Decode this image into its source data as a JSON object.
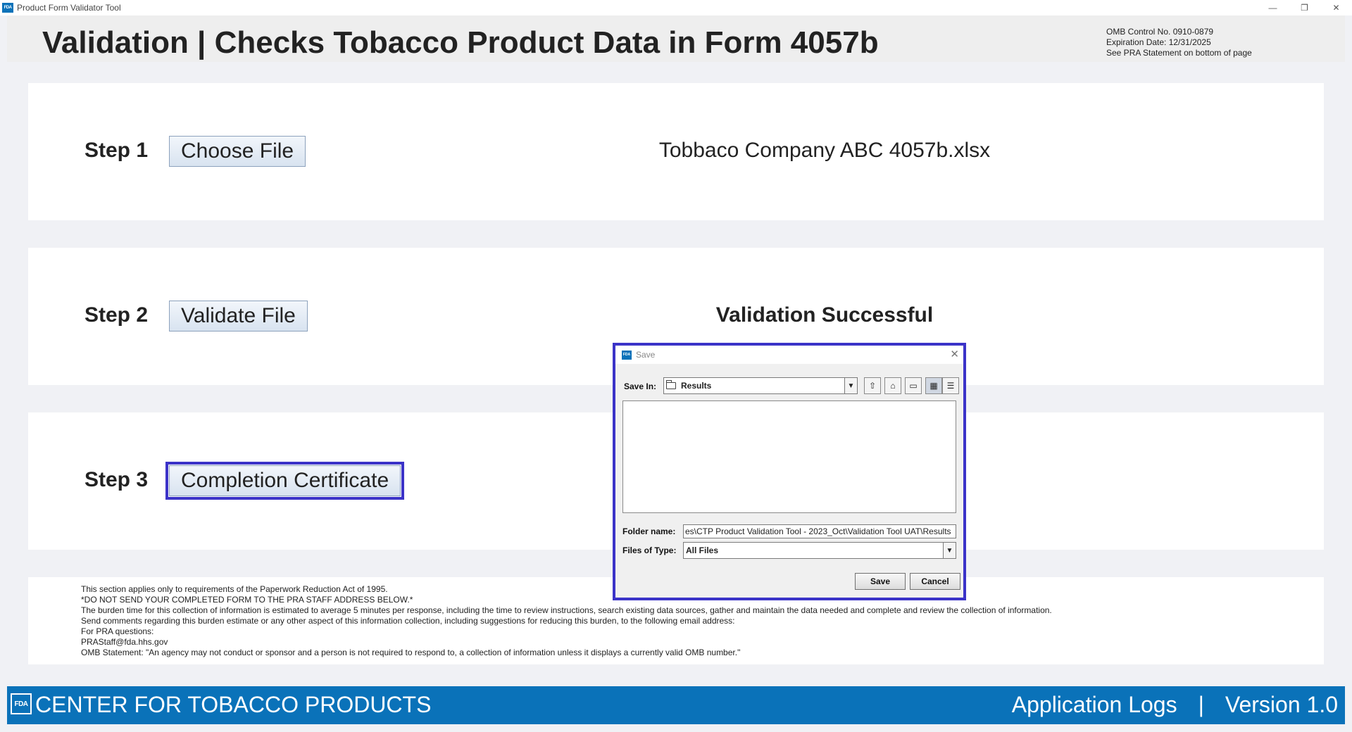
{
  "window": {
    "logo_text": "FDA",
    "title": "Product Form Validator Tool",
    "minimize": "—",
    "restore": "❐",
    "close": "✕"
  },
  "header": {
    "title": "Validation | Checks Tobacco Product Data in Form 4057b",
    "omb_control": "OMB Control No. 0910-0879",
    "expiration": "Expiration Date: 12/31/2025",
    "pra_note": "See PRA Statement on bottom of page"
  },
  "steps": {
    "step1": {
      "label": "Step 1",
      "button": "Choose File",
      "status": "Tobbaco Company ABC 4057b.xlsx"
    },
    "step2": {
      "label": "Step 2",
      "button": "Validate File",
      "status": "Validation Successful"
    },
    "step3": {
      "label": "Step 3",
      "button": "Completion Certificate"
    }
  },
  "pra": {
    "lines": [
      "This section applies only to requirements of the Paperwork Reduction Act of 1995.",
      "*DO NOT SEND YOUR COMPLETED FORM TO THE PRA STAFF ADDRESS BELOW.*",
      "The burden time for this collection of information is estimated to average 5 minutes per response, including the time to review instructions, search existing data sources, gather and maintain the data needed and complete and review the collection of information.",
      "Send comments regarding this burden estimate or any other aspect of this information collection, including suggestions for reducing this burden, to the following email address:",
      "For PRA questions:",
      "PRAStaff@fda.hhs.gov",
      "OMB Statement: \"An agency may not conduct or sponsor and a person is not required to respond to, a collection of information unless it displays a currently valid OMB number.\""
    ]
  },
  "footer": {
    "logo_text": "FDA",
    "org": "CENTER FOR TOBACCO PRODUCTS",
    "logs": "Application Logs",
    "separator": "|",
    "version": "Version 1.0"
  },
  "dialog": {
    "logo_text": "FDA",
    "title": "Save",
    "close": "✕",
    "save_in_label": "Save In:",
    "save_in_value": "Results",
    "folder_name_label": "Folder name:",
    "folder_name_value": "es\\CTP Product Validation Tool - 2023_Oct\\Validation Tool UAT\\Results",
    "files_of_type_label": "Files of Type:",
    "files_of_type_value": "All Files",
    "dropdown_arrow": "▼",
    "save_button": "Save",
    "cancel_button": "Cancel",
    "tools": [
      "⇧",
      "⌂",
      "▭",
      "▦",
      "☰"
    ]
  }
}
